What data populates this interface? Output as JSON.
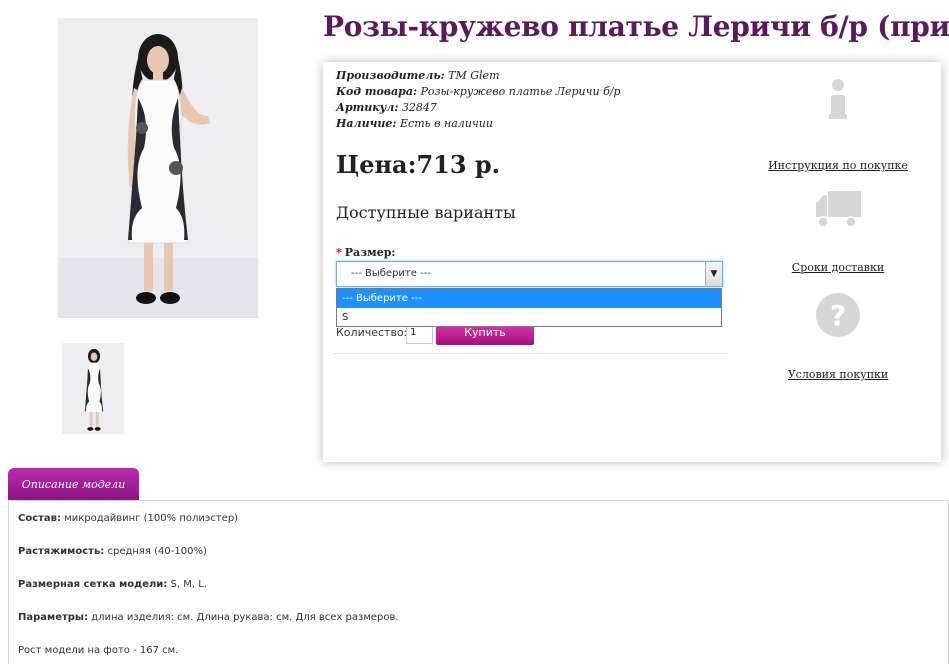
{
  "product": {
    "title": "Розы-кружево платье Леричи б/р (принт)",
    "manufacturer_label": "Производитель:",
    "manufacturer": "ТМ Glem",
    "code_label": "Код товара:",
    "code": "Розы-кружево платье Леричи б/р",
    "sku_label": "Артикул:",
    "sku": "32847",
    "stock_label": "Наличие:",
    "stock": "Есть в наличии",
    "price": "Цена:713 р."
  },
  "options": {
    "title": "Доступные варианты",
    "required_mark": "*",
    "size_label": "Размер:",
    "select_value": "--- Выберите ---",
    "dropdown_items": [
      "--- Выберите ---",
      "S"
    ],
    "quantity_label": "Количество:",
    "quantity_value": "1",
    "buy_label": "Купить"
  },
  "side_links": {
    "instructions": "Инструкция по покупке",
    "delivery": "Сроки доставки",
    "terms": "Условия покупки"
  },
  "tabs": {
    "description_tab": "Описание модели"
  },
  "description": {
    "composition_label": "Состав:",
    "composition": "микродайвинг (100% полиэстер)",
    "stretch_label": "Растяжимость:",
    "stretch": "средняя (40-100%)",
    "sizes_label": "Размерная сетка модели:",
    "sizes": "S, M, L.",
    "params_label": "Параметры:",
    "params": "длина изделия: см. Длина рукава: см. Для всех размеров.",
    "model_height": "Рост модели на фото - 167 см."
  },
  "colors": {
    "title": "#5a1a5c",
    "accent": "#b92bb0",
    "icon_gray": "#d6d6d6",
    "select_highlight": "#1e90ff"
  },
  "icons": [
    "info-icon",
    "delivery-truck-icon",
    "question-icon",
    "select-arrow-icon"
  ]
}
